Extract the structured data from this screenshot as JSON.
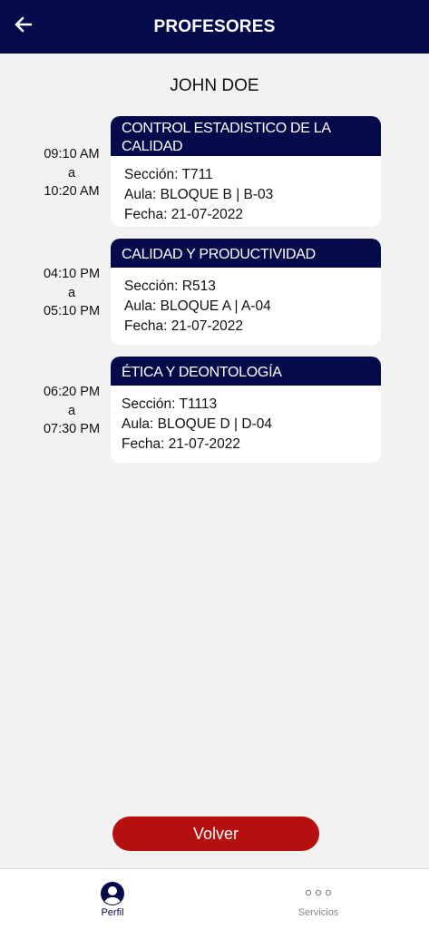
{
  "appbar": {
    "title": "PROFESORES",
    "back_icon": "arrow-left-icon"
  },
  "teacher": {
    "name": "JOHN DOE"
  },
  "schedule": [
    {
      "start": "09:10 AM",
      "sep": "a",
      "end": "10:20 AM",
      "course": "CONTROL ESTADISTICO DE LA CALIDAD",
      "seccion": "Sección: T711",
      "aula": "Aula: BLOQUE B | B-03",
      "fecha": "Fecha: 21-07-2022"
    },
    {
      "start": "04:10 PM",
      "sep": "a",
      "end": "05:10 PM",
      "course": "CALIDAD Y PRODUCTIVIDAD",
      "seccion": "Sección: R513",
      "aula": "Aula: BLOQUE A | A-04",
      "fecha": "Fecha: 21-07-2022"
    },
    {
      "start": "06:20 PM",
      "sep": "a",
      "end": "07:30 PM",
      "course": "ÉTICA Y DEONTOLOGÍA",
      "seccion": "Sección: T1113",
      "aula": "Aula: BLOQUE D | D-04",
      "fecha": "Fecha: 21-07-2022"
    }
  ],
  "actions": {
    "volver_label": "Volver"
  },
  "tabbar": {
    "tabs": [
      {
        "label": "Perfil",
        "icon": "user-circle-icon",
        "active": true
      },
      {
        "label": "Servicios",
        "icon": "more-dots-icon",
        "active": false
      }
    ]
  },
  "colors": {
    "primary": "#050a4a",
    "danger": "#b50f0f",
    "background": "#f2f2f2"
  }
}
